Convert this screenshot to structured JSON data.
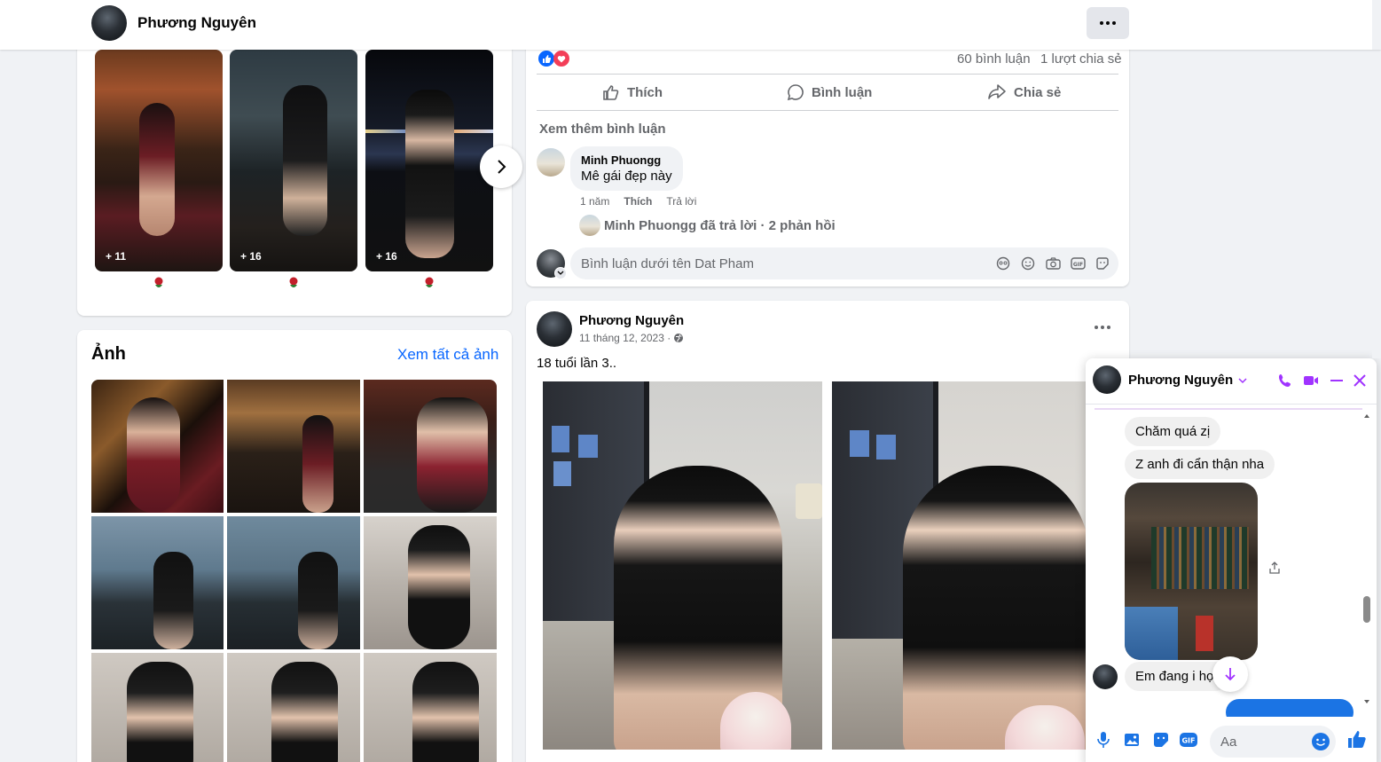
{
  "header": {
    "profile_name": "Phương Nguyên"
  },
  "featured": {
    "counts": [
      "+ 11",
      "+ 16",
      "+ 16"
    ]
  },
  "photos": {
    "title": "Ảnh",
    "see_all": "Xem tất cả ảnh"
  },
  "post1": {
    "comments_count": "60 bình luận",
    "shares_count": "1 lượt chia sẻ",
    "actions": {
      "like": "Thích",
      "comment": "Bình luận",
      "share": "Chia sẻ"
    },
    "more_comments": "Xem thêm bình luận",
    "comment": {
      "author": "Minh Phuongg",
      "text": "Mê gái đẹp này",
      "time": "1 năm",
      "like": "Thích",
      "reply": "Trả lời"
    },
    "replies": "Minh Phuongg đã trả lời · 2 phản hồi",
    "input_placeholder": "Bình luận dưới tên Dat Pham"
  },
  "post2": {
    "author": "Phương Nguyên",
    "date": "11 tháng 12, 2023 ·",
    "caption": "18 tuổi lần 3.."
  },
  "chat": {
    "name": "Phương Nguyên",
    "messages": [
      "Chăm quá zị",
      "Z anh đi cẩn thận nha",
      "Em đang i họ"
    ],
    "input_placeholder": "Aa"
  },
  "colors": {
    "brand": "#0866ff",
    "messenger": "#a033ff",
    "text": "#050505",
    "muted": "#65676b"
  }
}
